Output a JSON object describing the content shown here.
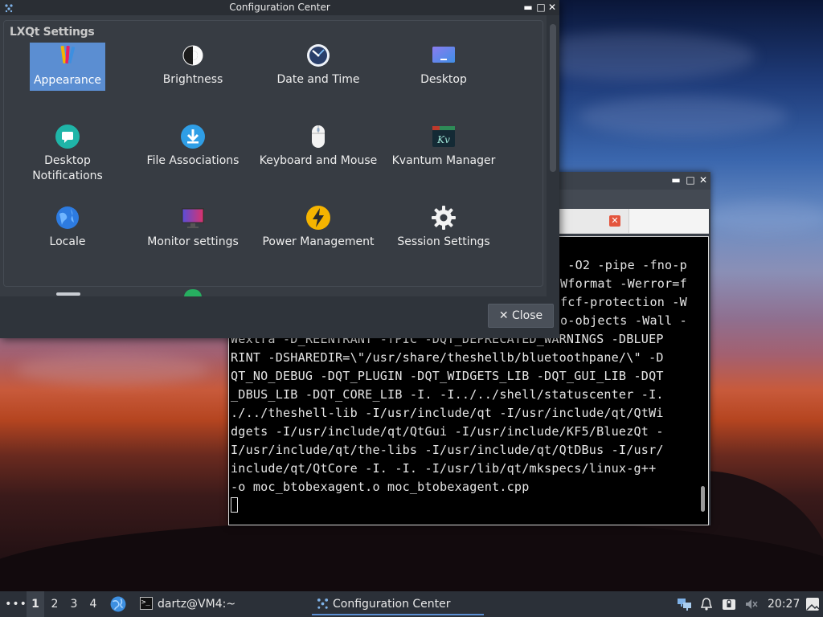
{
  "colors": {
    "accent": "#5b8ed2",
    "window_bg": "#2f343b",
    "panel_bg": "#373c43",
    "taskbar_bg": "#2b3038",
    "terminal_bg": "#000000"
  },
  "config_window": {
    "title": "Configuration Center",
    "window_controls": [
      "minimize",
      "maximize",
      "close"
    ],
    "group_title": "LXQt Settings",
    "items": [
      {
        "label": "Appearance",
        "icon": "appearance-icon",
        "selected": true
      },
      {
        "label": "Brightness",
        "icon": "brightness-icon"
      },
      {
        "label": "Date and Time",
        "icon": "clock-icon"
      },
      {
        "label": "Desktop",
        "icon": "desktop-icon"
      },
      {
        "label": "Desktop\nNotifications",
        "icon": "notification-icon"
      },
      {
        "label": "File Associations",
        "icon": "file-associations-icon"
      },
      {
        "label": "Keyboard and Mouse",
        "icon": "mouse-icon"
      },
      {
        "label": "Kvantum Manager",
        "icon": "kvantum-icon"
      },
      {
        "label": "Locale",
        "icon": "globe-icon"
      },
      {
        "label": "Monitor settings",
        "icon": "monitor-icon"
      },
      {
        "label": "Power Management",
        "icon": "power-icon"
      },
      {
        "label": "Session Settings",
        "icon": "gear-icon"
      }
    ],
    "close_label": "Close"
  },
  "terminal_window": {
    "output_lines": [
      " -O2 -pipe -fno-p",
      "Wformat -Werror=f",
      "fcf-protection -W",
      "o-objects -Wall -",
      "Wextra -D_REENTRANT -fPIC -DQT_DEPRECATED_WARNINGS -DBLUEP",
      "RINT -DSHAREDIR=\\\"/usr/share/theshellb/bluetoothpane/\\\" -D",
      "QT_NO_DEBUG -DQT_PLUGIN -DQT_WIDGETS_LIB -DQT_GUI_LIB -DQT",
      "_DBUS_LIB -DQT_CORE_LIB -I. -I../../shell/statuscenter -I.",
      "./../theshell-lib -I/usr/include/qt -I/usr/include/qt/QtWi",
      "dgets -I/usr/include/qt/QtGui -I/usr/include/KF5/BluezQt -",
      "I/usr/include/qt/the-libs -I/usr/include/qt/QtDBus -I/usr/",
      "include/qt/QtCore -I. -I. -I/usr/lib/qt/mkspecs/linux-g++",
      "-o moc_btobexagent.o moc_btobexagent.cpp"
    ]
  },
  "taskbar": {
    "menu_label": "•••",
    "desktops": [
      "1",
      "2",
      "3",
      "4"
    ],
    "active_desktop": "1",
    "tasks": [
      {
        "label": "dartz@VM4:~",
        "icon": "terminal-icon"
      },
      {
        "label": "Configuration Center",
        "icon": "settings-icon",
        "active": true
      }
    ],
    "tray_icons": [
      "network-icon",
      "bell-icon",
      "lock-icon",
      "mute-icon"
    ],
    "clock": "20:27"
  }
}
